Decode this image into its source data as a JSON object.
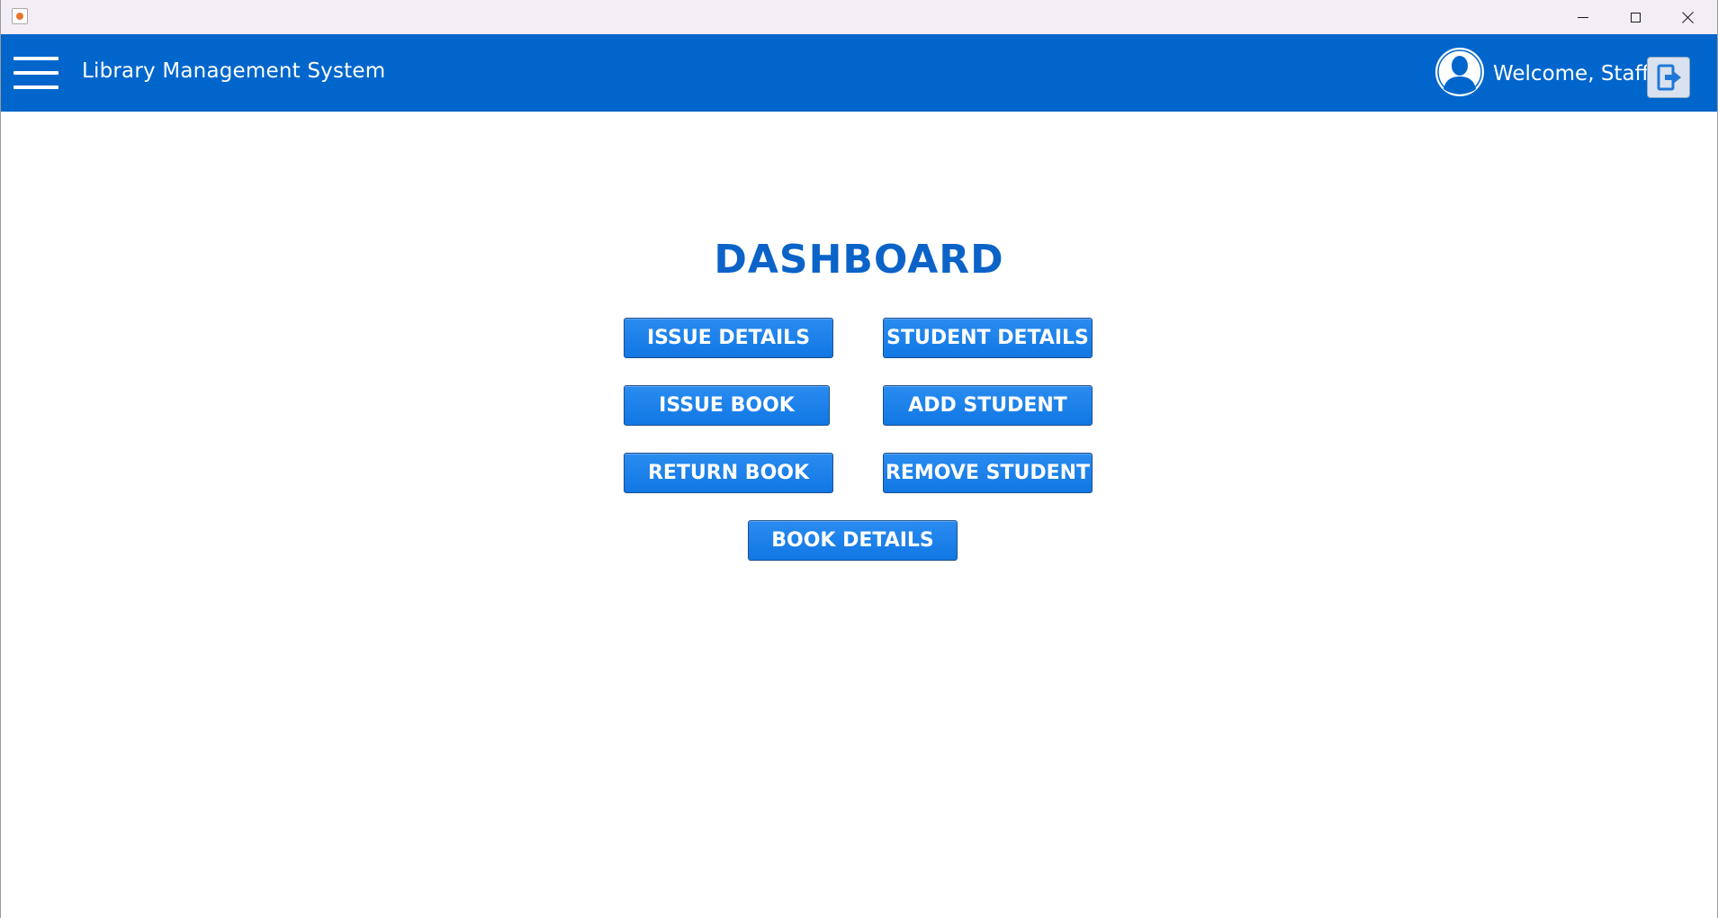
{
  "window": {
    "controls": [
      "minimize",
      "maximize",
      "close"
    ]
  },
  "header": {
    "title": "Library Management System",
    "welcome": "Welcome, Staff!"
  },
  "dashboard": {
    "title": "DASHBOARD",
    "buttons": {
      "issue_details": "ISSUE DETAILS",
      "student_details": "STUDENT DETAILS",
      "issue_book": "ISSUE BOOK",
      "add_student": "ADD STUDENT",
      "return_book": "RETURN BOOK",
      "remove_student": "REMOVE STUDENT",
      "book_details": "BOOK DETAILS"
    }
  },
  "colors": {
    "header_bg": "#0066cc",
    "button_bg": "#1a80ea",
    "title_text": "#0b63c8",
    "titlebar_bg": "#f3eef6"
  },
  "icons": {
    "menu": "hamburger-menu-icon",
    "user": "user-avatar-icon",
    "logout": "logout-icon"
  }
}
